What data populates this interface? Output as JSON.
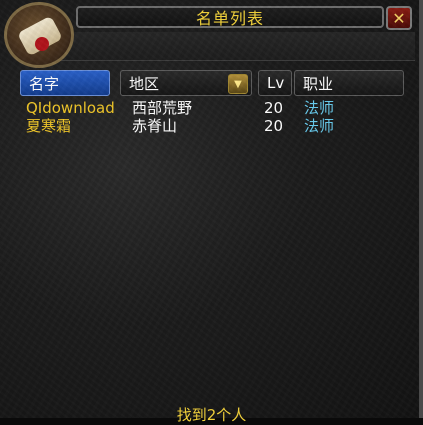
{
  "window": {
    "title": "名单列表",
    "close_symbol": "✕"
  },
  "icons": {
    "scroll": "scroll-icon",
    "close": "close-icon",
    "dropdown": "chevron-down-icon"
  },
  "header": {
    "name": "名字",
    "zone": "地区",
    "dropdown_symbol": "▼",
    "level": "Lv",
    "class": "职业"
  },
  "rows": [
    {
      "name": "QIdownload",
      "zone": "西部荒野",
      "level": "20",
      "class": "法师"
    },
    {
      "name": "夏寒霜",
      "zone": "赤脊山",
      "level": "20",
      "class": "法师"
    }
  ],
  "footer": {
    "text": "找到2个人"
  },
  "colors": {
    "title_text": "#f3d23a",
    "name_text": "#f0c628",
    "class_text": "#68ccef",
    "active_header": "#2a60c8"
  }
}
